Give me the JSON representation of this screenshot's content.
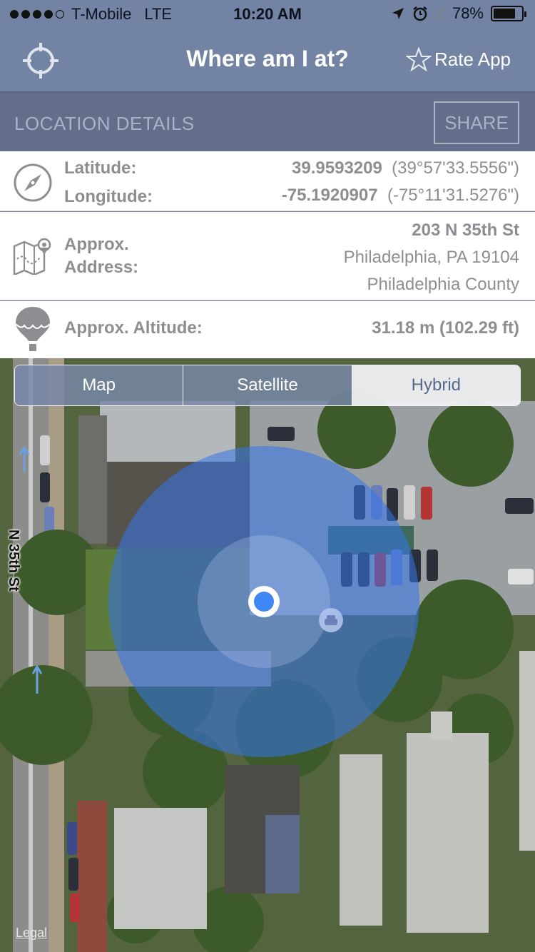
{
  "status": {
    "carrier": "T-Mobile",
    "network": "LTE",
    "time": "10:20 AM",
    "battery": "78%",
    "battery_level": 0.78
  },
  "nav": {
    "title": "Where am I at?",
    "rate_label": "Rate App",
    "locate_icon": "crosshair-icon",
    "rate_icon": "star-outline-icon"
  },
  "section": {
    "label": "LOCATION DETAILS",
    "share_label": "SHARE"
  },
  "details": {
    "latitude_label": "Latitude:",
    "latitude_value": "39.9593209",
    "latitude_dms": "(39°57'33.5556\")",
    "longitude_label": "Longitude:",
    "longitude_value": "-75.1920907",
    "longitude_dms": "(-75°11'31.5276\")",
    "address_label_1": "Approx.",
    "address_label_2": "Address:",
    "address_line1": "203 N 35th St",
    "address_line2": "Philadelphia, PA 19104",
    "address_line3": "Philadelphia County",
    "altitude_label": "Approx. Altitude:",
    "altitude_value": "31.18 m (102.29 ft)"
  },
  "map": {
    "segments": [
      "Map",
      "Satellite",
      "Hybrid"
    ],
    "selected_segment": "Hybrid",
    "street_label": "N 35th St",
    "legal": "Legal"
  },
  "colors": {
    "nav_bg": "#7283a3",
    "section_bg": "#636f8a",
    "location_dot": "#3f86f5",
    "accuracy_circle": "#2f6fe0"
  }
}
